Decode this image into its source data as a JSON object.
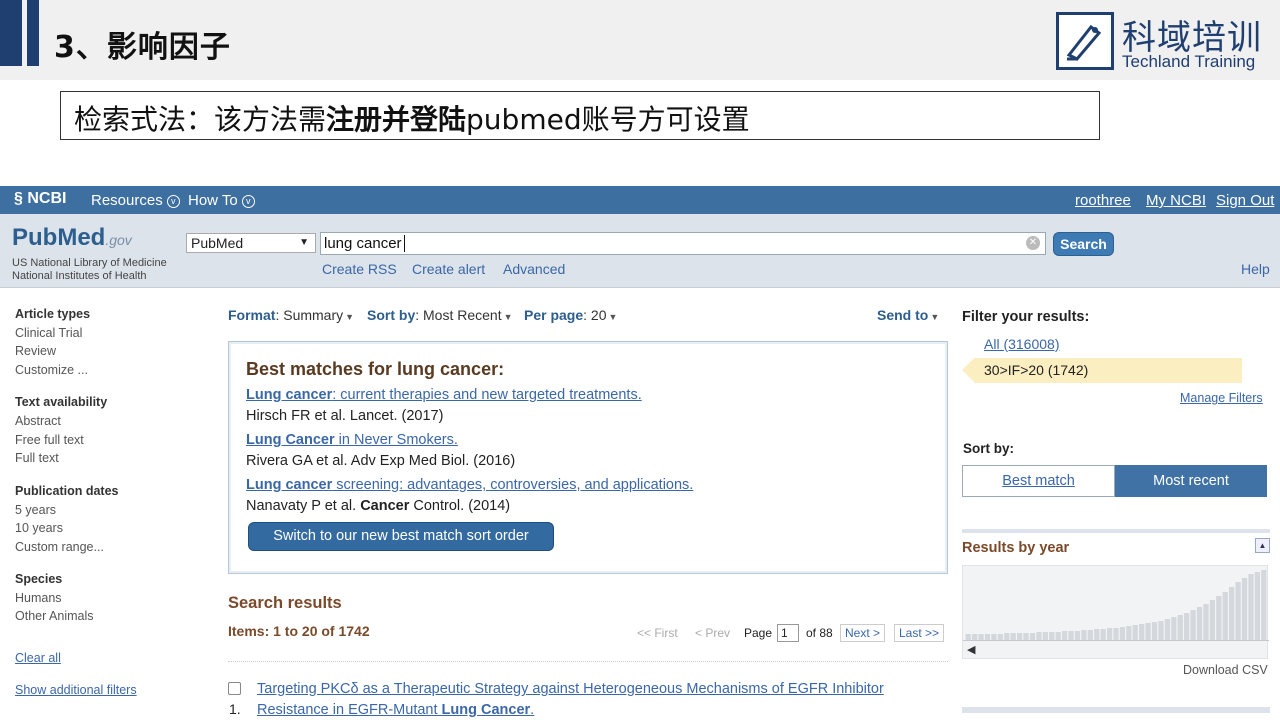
{
  "slide": {
    "title": "3、影响因子",
    "logo_cn": "科域培训",
    "logo_en": "Techland Training",
    "note_prefix": "检索式法：该方法需",
    "note_bold": "注册并登陆",
    "note_suffix": "pubmed账号方可设置"
  },
  "ncbi_bar": {
    "logo": "NCBI",
    "resources": "Resources",
    "howto": "How To",
    "user": "roothree",
    "myncbi": "My NCBI",
    "signout": "Sign Out"
  },
  "search": {
    "logo_pub": "Pub",
    "logo_med": "Med",
    "logo_gov": ".gov",
    "nlm_line1": "US National Library of Medicine",
    "nlm_line2": "National Institutes of Health",
    "database": "PubMed",
    "query": "lung cancer",
    "button": "Search",
    "create_rss": "Create RSS",
    "create_alert": "Create alert",
    "advanced": "Advanced",
    "help": "Help"
  },
  "sidebar": {
    "article_types_h": "Article types",
    "clinical_trial": "Clinical Trial",
    "review": "Review",
    "customize": "Customize ...",
    "text_avail_h": "Text availability",
    "abstract": "Abstract",
    "free_full": "Free full text",
    "full_text": "Full text",
    "pub_dates_h": "Publication dates",
    "five_years": "5 years",
    "ten_years": "10 years",
    "custom_range": "Custom range...",
    "species_h": "Species",
    "humans": "Humans",
    "other_animals": "Other Animals",
    "clear_all": "Clear all",
    "show_filters": "Show additional filters"
  },
  "format_row": {
    "format_label": "Format",
    "format_value": "Summary",
    "sort_label": "Sort by",
    "sort_value": "Most Recent",
    "perpage_label": "Per page",
    "perpage_value": "20",
    "send_to": "Send to"
  },
  "best_matches": {
    "title": "Best matches for lung cancer:",
    "items": [
      {
        "bold": "Lung cancer",
        "rest": ": current therapies and new targeted treatments.",
        "cite": "Hirsch FR et al. Lancet. (2017)"
      },
      {
        "bold": "Lung Cancer",
        "rest": " in Never Smokers.",
        "cite": "Rivera GA et al. Adv Exp Med Biol. (2016)"
      },
      {
        "bold": "Lung cancer",
        "rest": " screening: advantages, controversies, and applications.",
        "cite_pre": "Nanavaty P et al. ",
        "cite_bold": "Cancer",
        "cite_post": " Control. (2014)"
      }
    ],
    "switch_button": "Switch to our new best match sort order"
  },
  "results": {
    "heading": "Search results",
    "items": "Items: 1 to 20 of 1742",
    "first": "<< First",
    "prev": "< Prev",
    "page_label": "Page",
    "page_value": "1",
    "of_pages": "of 88",
    "next": "Next >",
    "last": "Last >>",
    "first_number": "1.",
    "first_title_line1": "Targeting PKCδ as a Therapeutic Strategy against Heterogeneous Mechanisms of EGFR Inhibitor",
    "first_title_line2_pre": "Resistance in EGFR-Mutant ",
    "first_title_line2_bold": "Lung Cancer",
    "first_title_line2_post": "."
  },
  "right": {
    "filter_h": "Filter your results:",
    "all": "All (316008)",
    "selected_filter": "30>IF>20 (1742)",
    "manage": "Manage Filters",
    "sortby_h": "Sort by:",
    "best_match": "Best match",
    "most_recent": "Most recent",
    "results_by_year": "Results by year",
    "download_csv": "Download CSV"
  },
  "chart_data": {
    "type": "bar",
    "title": "Results by year",
    "values": [
      6,
      6,
      6,
      6,
      6,
      6,
      7,
      7,
      7,
      7,
      7,
      8,
      8,
      8,
      8,
      9,
      9,
      9,
      10,
      10,
      11,
      11,
      12,
      12,
      13,
      14,
      15,
      16,
      17,
      18,
      19,
      21,
      23,
      25,
      27,
      30,
      33,
      36,
      40,
      44,
      48,
      53,
      58,
      62,
      66,
      68,
      70
    ],
    "ylim": [
      0,
      72
    ]
  },
  "colors": {
    "ncbi_bar": "#3d6fa0",
    "link": "#3a67a8",
    "accent_brown": "#7a4a2a",
    "filter_highlight": "#fbeec1",
    "slide_navy": "#1f3f70"
  }
}
